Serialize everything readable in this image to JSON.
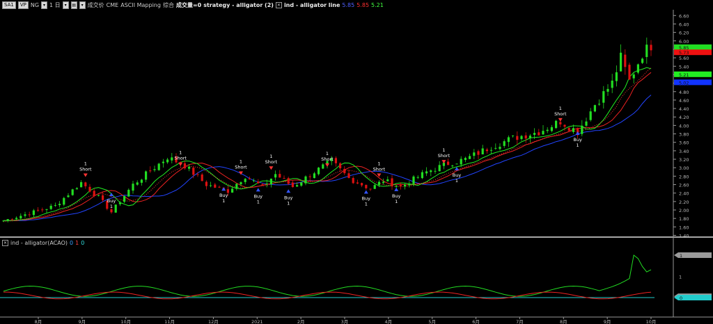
{
  "toolbar": {
    "symbol_btn": "SA1",
    "vp_btn": "VP",
    "exchange": "NG",
    "interval": "1 日",
    "volume_type": "成交价",
    "source": "CME",
    "mapping": "ASCII Mapping",
    "session": "综合",
    "volume_label": "成交量=0",
    "strategy": "strategy - alligator (2)",
    "indicator": "ind - alligator line",
    "ind_v1": "5.85",
    "ind_v2": "5.85",
    "ind_v3": "5.21"
  },
  "price_axis": {
    "ticks": [
      "6.60",
      "6.40",
      "6.20",
      "6.00",
      "5.80",
      "5.60",
      "5.40",
      "5.20",
      "5.00",
      "4.80",
      "4.60",
      "4.40",
      "4.20",
      "4.00",
      "3.80",
      "3.60",
      "3.40",
      "3.20",
      "3.00",
      "2.80",
      "2.60",
      "2.40",
      "2.20",
      "2.00",
      "1.80",
      "1.60",
      "1.40"
    ],
    "tags": [
      {
        "value": "5.85",
        "color": "#22dd22"
      },
      {
        "value": "5.73",
        "color": "#ee1111"
      },
      {
        "value": "5.21",
        "color": "#22ee22"
      },
      {
        "value": "5.02",
        "color": "#1133ff"
      }
    ]
  },
  "indicator_panel": {
    "title": "ind - alligator(ACAO)",
    "values": [
      "0",
      "1",
      "0"
    ],
    "axis_label": "1",
    "tags": [
      {
        "value": "1",
        "color": "#9a9a9a",
        "level": 1.0
      },
      {
        "value": "0",
        "color": "#9a9a9a",
        "level": 0.03
      },
      {
        "value": "0",
        "color": "#22cccc",
        "level": 0.0
      }
    ]
  },
  "time_axis": [
    "8月",
    "9月",
    "10月",
    "11月",
    "12月",
    "2021",
    "2月",
    "3月",
    "4月",
    "5月",
    "6月",
    "7月",
    "8月",
    "9月",
    "10月"
  ],
  "signals": [
    {
      "type": "Short",
      "qty": "1",
      "bar": 19,
      "price": 2.83
    },
    {
      "type": "Buy",
      "qty": "1",
      "bar": 25,
      "price": 2.36
    },
    {
      "type": "Short",
      "qty": "1",
      "bar": 41,
      "price": 3.09
    },
    {
      "type": "Buy",
      "qty": "1",
      "bar": 51,
      "price": 2.49
    },
    {
      "type": "Short",
      "qty": "1",
      "bar": 55,
      "price": 2.88
    },
    {
      "type": "Buy",
      "qty": "1",
      "bar": 59,
      "price": 2.47
    },
    {
      "type": "Short",
      "qty": "1",
      "bar": 62,
      "price": 3.0
    },
    {
      "type": "Buy",
      "qty": "1",
      "bar": 66,
      "price": 2.44
    },
    {
      "type": "Short",
      "qty": "1",
      "bar": 75,
      "price": 3.07
    },
    {
      "type": "Buy",
      "qty": "1",
      "bar": 84,
      "price": 2.42
    },
    {
      "type": "Short",
      "qty": "1",
      "bar": 87,
      "price": 2.83
    },
    {
      "type": "Buy",
      "qty": "1",
      "bar": 91,
      "price": 2.48
    },
    {
      "type": "Short",
      "qty": "1",
      "bar": 102,
      "price": 3.15
    },
    {
      "type": "Buy",
      "qty": "1",
      "bar": 105,
      "price": 2.97
    },
    {
      "type": "Short",
      "qty": "1",
      "bar": 129,
      "price": 4.14
    },
    {
      "type": "Buy",
      "qty": "1",
      "bar": 133,
      "price": 3.81
    }
  ]
}
